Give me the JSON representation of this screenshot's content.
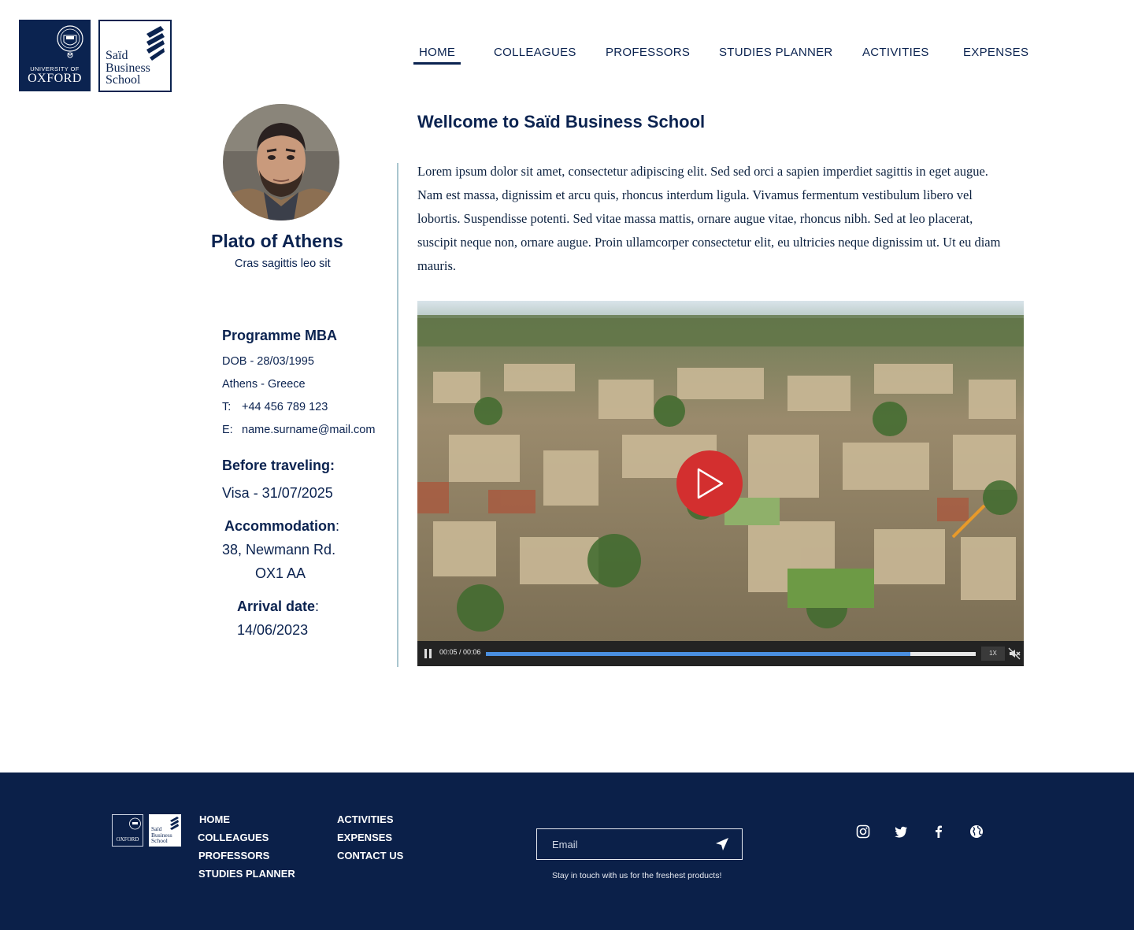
{
  "brand": {
    "oxford_small": "UNIVERSITY OF",
    "oxford_big": "OXFORD",
    "said_words": [
      "Saïd",
      "Business",
      "School"
    ]
  },
  "nav": {
    "items": [
      "HOME",
      "COLLEAGUES",
      "PROFESSORS",
      "STUDIES PLANNER",
      "ACTIVITIES",
      "EXPENSES"
    ],
    "active": "HOME"
  },
  "profile": {
    "name": "Plato of Athens",
    "subtitle": "Cras sagittis leo sit",
    "programme": "Programme MBA",
    "dob": "DOB - 28/03/1995",
    "location": "Athens - Greece",
    "phone_label": "T:",
    "phone": "+44 456 789 123",
    "email_label": "E:",
    "email": "name.surname@mail.com",
    "before_title": "Before traveling:",
    "before_value": "Visa - 31/07/2025",
    "accommodation_title": "Accommodation",
    "accommodation_line1": "38, Newmann Rd.",
    "accommodation_line2": "OX1 AA",
    "arrival_title": "Arrival date",
    "arrival_value": "14/06/2023",
    "colon": ":"
  },
  "main": {
    "welcome": "Wellcome to Saïd Business School",
    "body": "Lorem ipsum dolor sit amet, consectetur adipiscing elit. Sed sed orci a sapien imperdiet sagittis in eget augue. Nam est massa, dignissim et arcu quis, rhoncus interdum ligula. Vivamus fermentum vestibulum libero vel lobortis. Suspendisse potenti. Sed vitae massa mattis, ornare augue vitae, rhoncus nibh. Sed at leo placerat, suscipit neque non, ornare augue. Proin ullamcorper consectetur elit, eu ultricies neque dignissim ut. Ut eu diam mauris."
  },
  "video": {
    "time": "00:05 / 00:06",
    "progress": 0.866,
    "speed": "1X",
    "muted": true,
    "play_color": "#d32f2f",
    "progress_color": "#4a8fe0"
  },
  "footer": {
    "col1": [
      "HOME",
      "COLLEAGUES",
      "PROFESSORS",
      "STUDIES PLANNER"
    ],
    "col2": [
      "ACTIVITIES",
      "EXPENSES",
      "CONTACT US"
    ],
    "email_placeholder": "Email",
    "tagline": "Stay in touch with us for the freshest products!",
    "social": [
      "instagram-icon",
      "twitter-icon",
      "facebook-icon",
      "globe-icon"
    ],
    "logo_small": "OXFORD",
    "said_small": [
      "Saïd",
      "Business",
      "School"
    ],
    "background": "#0b2049"
  },
  "colors": {
    "brand_navy": "#0b2350",
    "divider": "#a9c6cf"
  }
}
